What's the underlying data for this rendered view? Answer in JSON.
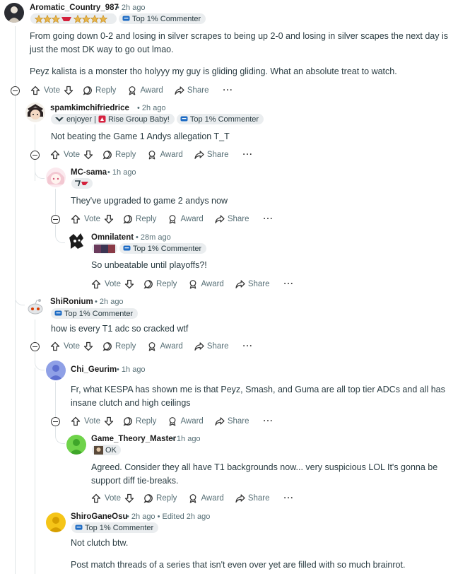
{
  "actions": {
    "vote": "Vote",
    "reply": "Reply",
    "award": "Award",
    "share": "Share",
    "more": "···"
  },
  "comments": [
    {
      "user": "Aromatic_Country_987",
      "time": "• 2h ago",
      "badge": "Top 1% Commenter",
      "body": "From going down 0-2 and losing in silver scrapes to being up 2-0 and losing in silver scapes the next day is just the most DK way to go out lmao.",
      "body2": "Peyz kalista is a monster tho holyyy my guy is gliding gliding. What an absolute treat to watch."
    },
    {
      "user": "spamkimchifriedrice",
      "time": "• 2h ago",
      "flair1": "enjoyer |",
      "flair2": "Rise Group Baby!",
      "badge": "Top 1% Commenter",
      "body": "Not beating the Game 1 Andys allegation T_T"
    },
    {
      "user": "MC-sama",
      "time": "• 1h ago",
      "body": "They've upgraded to game 2 andys now"
    },
    {
      "user": "Omnilatent",
      "time": "• 28m ago",
      "badge": "Top 1% Commenter",
      "body": "So unbeatable until playoffs?!"
    },
    {
      "user": "ShiRonium",
      "time": "• 2h ago",
      "badge": "Top 1% Commenter",
      "body": "how is every T1 adc so cracked wtf"
    },
    {
      "user": "Chi_Geurim",
      "time": "• 1h ago",
      "body": "Fr, what KESPA has shown me is that Peyz, Smash, and Guma are all top tier ADCs and all has insane clutch and high ceilings"
    },
    {
      "user": "Game_Theory_Master",
      "time": "• 1h ago",
      "flair": "OK",
      "body": "Agreed. Consider they all have T1 backgrounds now... very suspicious LOL It's gonna be support diff tie-breaks."
    },
    {
      "user": "ShiroGaneOsu",
      "time": "• 2h ago • Edited 2h ago",
      "badge": "Top 1% Commenter",
      "body": "Not clutch btw.",
      "body2": "Post match threads of a series that isn't even over yet are filled with so much brainrot."
    }
  ],
  "colors": {
    "badge_bg": "#eaedef",
    "text": "#2a3c42",
    "meta": "#576f76"
  }
}
